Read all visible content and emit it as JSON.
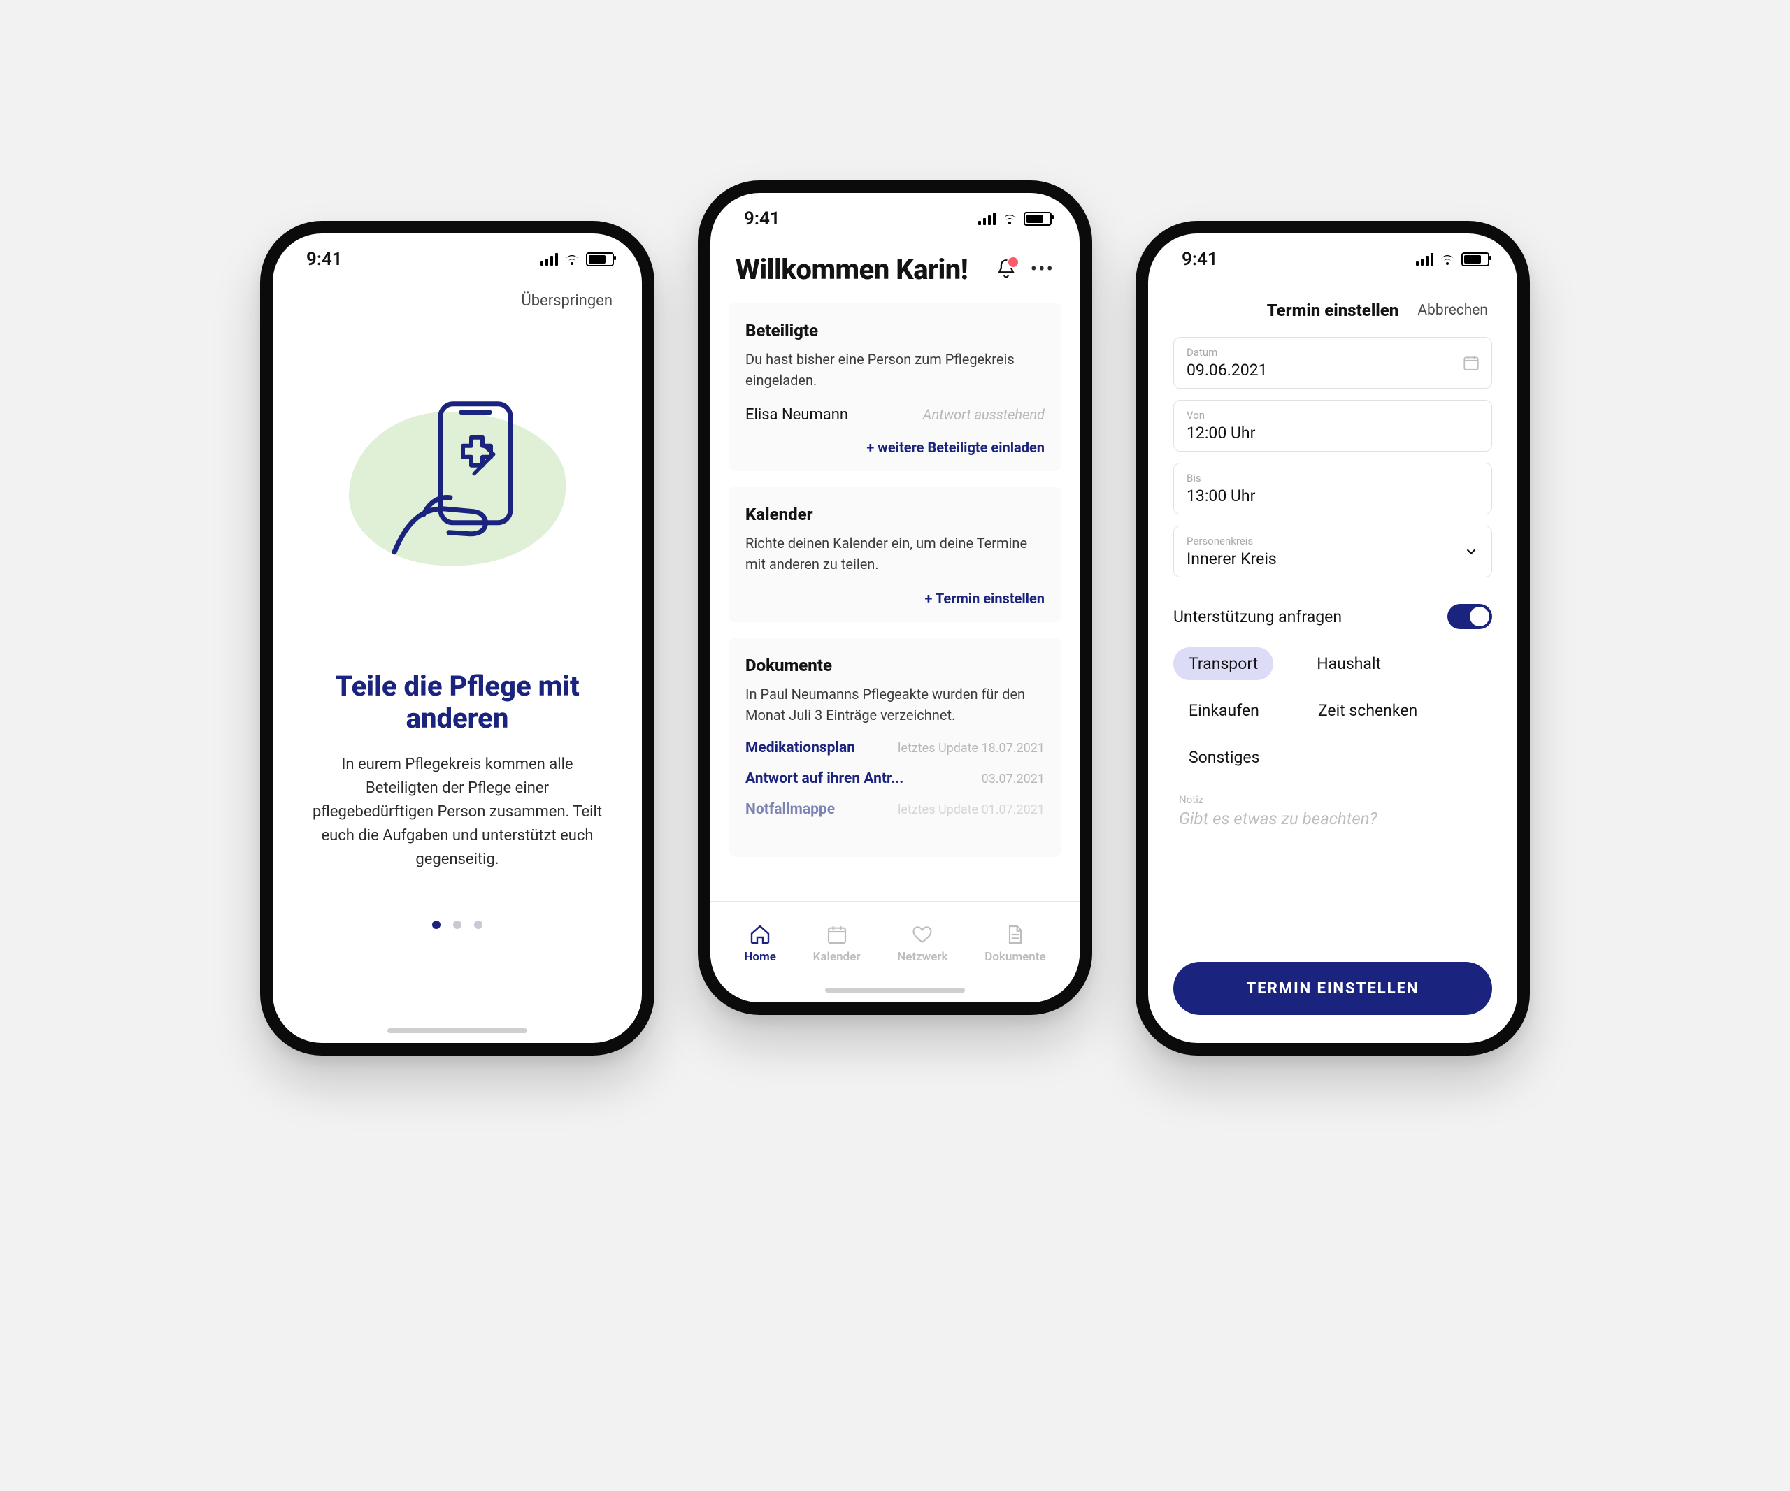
{
  "status": {
    "time": "9:41"
  },
  "screen1": {
    "skip": "Überspringen",
    "title": "Teile die Pflege mit anderen",
    "body": "In eurem Pflegekreis kommen alle Beteiligten der Pflege einer pflegebedürftigen Person zusammen. Teilt euch die Aufgaben und unterstützt euch gegenseitig.",
    "page_index": 0,
    "page_count": 3
  },
  "screen2": {
    "title": "Willkommen Karin!",
    "notifications": 1,
    "beteiligte": {
      "heading": "Beteiligte",
      "subtitle": "Du hast bisher eine Person zum Pflegekreis eingeladen.",
      "person": {
        "name": "Elisa Neumann",
        "status": "Antwort ausstehend"
      },
      "link": "+ weitere Beteiligte einladen"
    },
    "kalender": {
      "heading": "Kalender",
      "subtitle": "Richte deinen Kalender ein, um deine Termine mit anderen zu teilen.",
      "link": "+ Termin einstellen"
    },
    "dokumente": {
      "heading": "Dokumente",
      "subtitle": "In Paul Neumanns Pflegeakte wurden für den Monat Juli 3 Einträge verzeichnet.",
      "items": [
        {
          "name": "Medikationsplan",
          "meta": "letztes Update 18.07.2021"
        },
        {
          "name": "Antwort auf ihren Antr...",
          "meta": "03.07.2021"
        },
        {
          "name": "Notfallmappe",
          "meta": "letztes Update 01.07.2021"
        }
      ]
    },
    "tabs": {
      "home": "Home",
      "kalender": "Kalender",
      "netzwerk": "Netzwerk",
      "dokumente": "Dokumente"
    }
  },
  "screen3": {
    "title": "Termin einstellen",
    "cancel": "Abbrechen",
    "fields": {
      "date": {
        "label": "Datum",
        "value": "09.06.2021"
      },
      "from": {
        "label": "Von",
        "value": "12:00 Uhr"
      },
      "to": {
        "label": "Bis",
        "value": "13:00 Uhr"
      },
      "circle": {
        "label": "Personenkreis",
        "value": "Innerer Kreis"
      }
    },
    "support_label": "Unterstützung anfragen",
    "support_on": true,
    "chips": [
      "Transport",
      "Haushalt",
      "Einkaufen",
      "Zeit schenken",
      "Sonstiges"
    ],
    "chip_selected": "Transport",
    "note": {
      "label": "Notiz",
      "placeholder": "Gibt es etwas zu beachten?"
    },
    "submit": "TERMIN EINSTELLEN"
  }
}
